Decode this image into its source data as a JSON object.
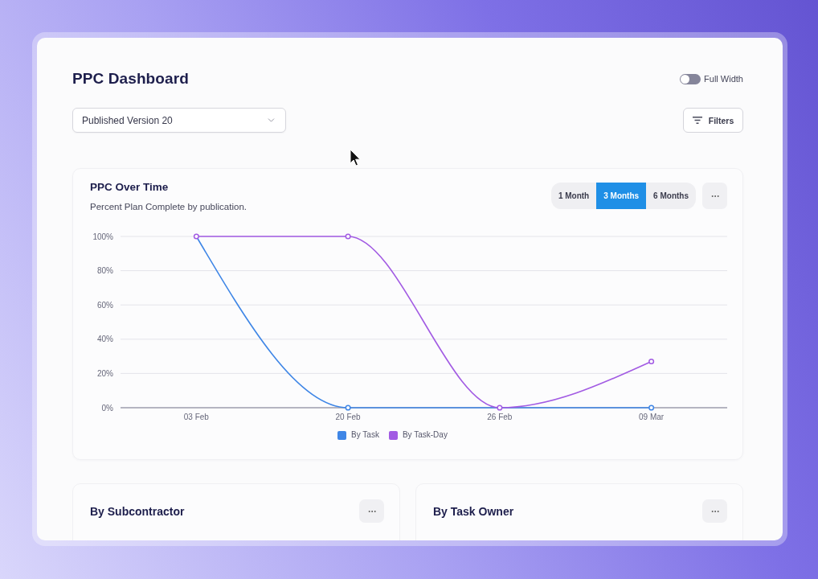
{
  "page": {
    "title": "PPC Dashboard"
  },
  "full_width_toggle": {
    "label": "Full Width",
    "on": false
  },
  "version_select": {
    "value": "Published Version 20"
  },
  "filters_button": {
    "label": "Filters"
  },
  "ppc_over_time": {
    "title": "PPC Over Time",
    "subtitle": "Percent Plan Complete by publication.",
    "ranges": [
      {
        "label": "1 Month",
        "selected": false
      },
      {
        "label": "3 Months",
        "selected": true
      },
      {
        "label": "6 Months",
        "selected": false
      }
    ],
    "chart_data": {
      "type": "line",
      "categories": [
        "03 Feb",
        "20 Feb",
        "26 Feb",
        "09 Mar"
      ],
      "series": [
        {
          "name": "By Task",
          "color": "#3f86e6",
          "marker": "circle",
          "values": [
            100,
            0,
            0,
            0
          ]
        },
        {
          "name": "By Task-Day",
          "color": "#a25be3",
          "marker": "circle",
          "values": [
            100,
            100,
            0,
            27
          ]
        }
      ],
      "ylim": [
        0,
        100
      ],
      "yticks": [
        {
          "value": 0,
          "label": "0%"
        },
        {
          "value": 20,
          "label": "20%"
        },
        {
          "value": 40,
          "label": "40%"
        },
        {
          "value": 60,
          "label": "60%"
        },
        {
          "value": 80,
          "label": "80%"
        },
        {
          "value": 100,
          "label": "100%"
        }
      ],
      "grid": true,
      "legend": true
    }
  },
  "panels": [
    {
      "title": "By Subcontractor"
    },
    {
      "title": "By Task Owner"
    }
  ]
}
